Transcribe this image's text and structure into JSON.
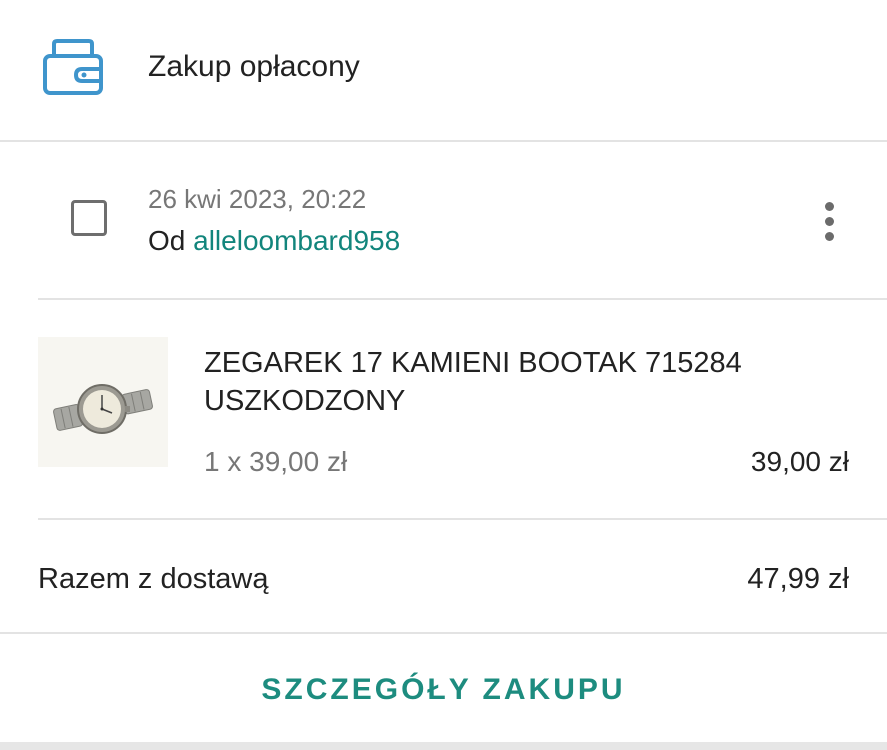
{
  "header": {
    "title": "Zakup opłacony",
    "icon": "wallet-icon",
    "icon_color": "#3f95cc"
  },
  "order": {
    "date": "26 kwi 2023, 20:22",
    "from_label": "Od",
    "seller": "alleloombard958",
    "seller_color": "#12857c",
    "checked": false,
    "menu_icon": "more-vert-icon"
  },
  "item": {
    "name": "ZEGAREK 17 KAMIENI BOOTAK 715284 USZKODZONY",
    "quantity_price": "1 x 39,00 zł",
    "price": "39,00 zł",
    "image": "watch-image"
  },
  "total": {
    "label": "Razem z dostawą",
    "value": "47,99 zł"
  },
  "actions": {
    "details_label": "SZCZEGÓŁY ZAKUPU",
    "details_color": "#1d8c7f"
  }
}
